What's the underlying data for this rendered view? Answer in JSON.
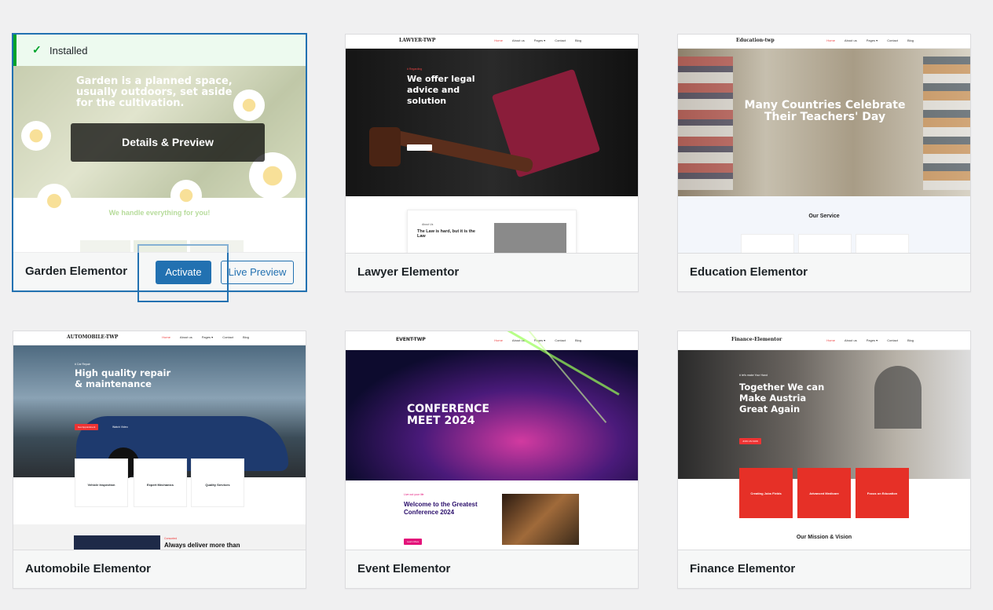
{
  "notice": {
    "text": "Installed",
    "icon": "check-icon"
  },
  "overlay": {
    "details_label": "Details & Preview"
  },
  "buttons": {
    "activate": "Activate",
    "live_preview": "Live Preview"
  },
  "themes": [
    {
      "name": "Garden Elementor",
      "hero": "Garden is a planned space, usually outdoors, set aside for the cultivation.",
      "sub": "We handle everything for you!"
    },
    {
      "name": "Lawyer Elementor",
      "logo": "LAWYER-TWP",
      "nav": [
        "Home",
        "About us",
        "Pages ▾",
        "Contact",
        "Blog"
      ],
      "kicker": "# Regarding",
      "hero": "We offer legal advice and solution",
      "card_kicker": "About Us",
      "card_title": "The Law is hard, but it is the Law"
    },
    {
      "name": "Education Elementor",
      "logo": "Education-twp",
      "nav": [
        "Home",
        "About us",
        "Pages ▾",
        "Contact",
        "Blog"
      ],
      "hero": "Many Countries Celebrate Their Teachers' Day",
      "service": "Our Service"
    },
    {
      "name": "Automobile Elementor",
      "logo": "AUTOMOBILE-TWP",
      "nav": [
        "Home",
        "About us",
        "Pages ▾",
        "Contact",
        "Blog"
      ],
      "kicker": "# Car Repair",
      "hero": "High quality repair & maintenance",
      "cta": "Get Appointment",
      "cta2": "Watch Video",
      "services": [
        "Vehicle Inspection",
        "Expert Mechanics",
        "Quality Services"
      ],
      "bottom_kicker": "Consorted",
      "bottom": "Always deliver more than"
    },
    {
      "name": "Event Elementor",
      "logo": "EVENT-TWP",
      "nav": [
        "Home",
        "About us",
        "Pages ▾",
        "Contact",
        "Blog"
      ],
      "hero": "CONFERENCE MEET 2024",
      "kicker": "Live out your life",
      "welcome": "Welcome to the Greatest Conference 2024",
      "cta": "Learn More"
    },
    {
      "name": "Finance Elementor",
      "logo": "Finance-Elementor",
      "nav": [
        "Home",
        "About us",
        "Pages ▾",
        "Contact",
        "Blog"
      ],
      "kicker": "# let's make Your Hand",
      "hero": "Together We can Make Austria Great Again",
      "cta": "JOIN US NOW",
      "boxes": [
        "Creating Jobs Fields",
        "Advanced Medicare",
        "Focus on Education"
      ],
      "mission": "Our Mission & Vision"
    }
  ]
}
